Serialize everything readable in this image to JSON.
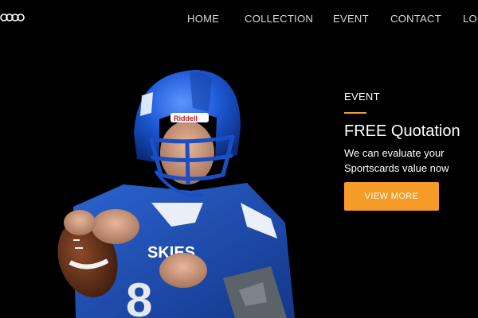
{
  "brand": {
    "logo_icon": "olympic-rings-icon"
  },
  "nav": {
    "items": [
      {
        "label": "HOME"
      },
      {
        "label": "COLLECTION"
      },
      {
        "label": "EVENT"
      },
      {
        "label": "CONTACT"
      },
      {
        "label": "LOGIN"
      }
    ]
  },
  "hero": {
    "image_subject": "football-player-photo",
    "helmet_brand": "Riddell",
    "jersey_text": "SKIES",
    "jersey_number": "8"
  },
  "promo": {
    "label": "EVENT",
    "title": "FREE Quotation",
    "subtitle_line1": "We can evaluate your",
    "subtitle_line2": "Sportscards value now",
    "cta_label": "VIEW MORE"
  },
  "colors": {
    "accent": "#f59c28",
    "background": "#000000",
    "jersey": "#1c4fb8"
  }
}
